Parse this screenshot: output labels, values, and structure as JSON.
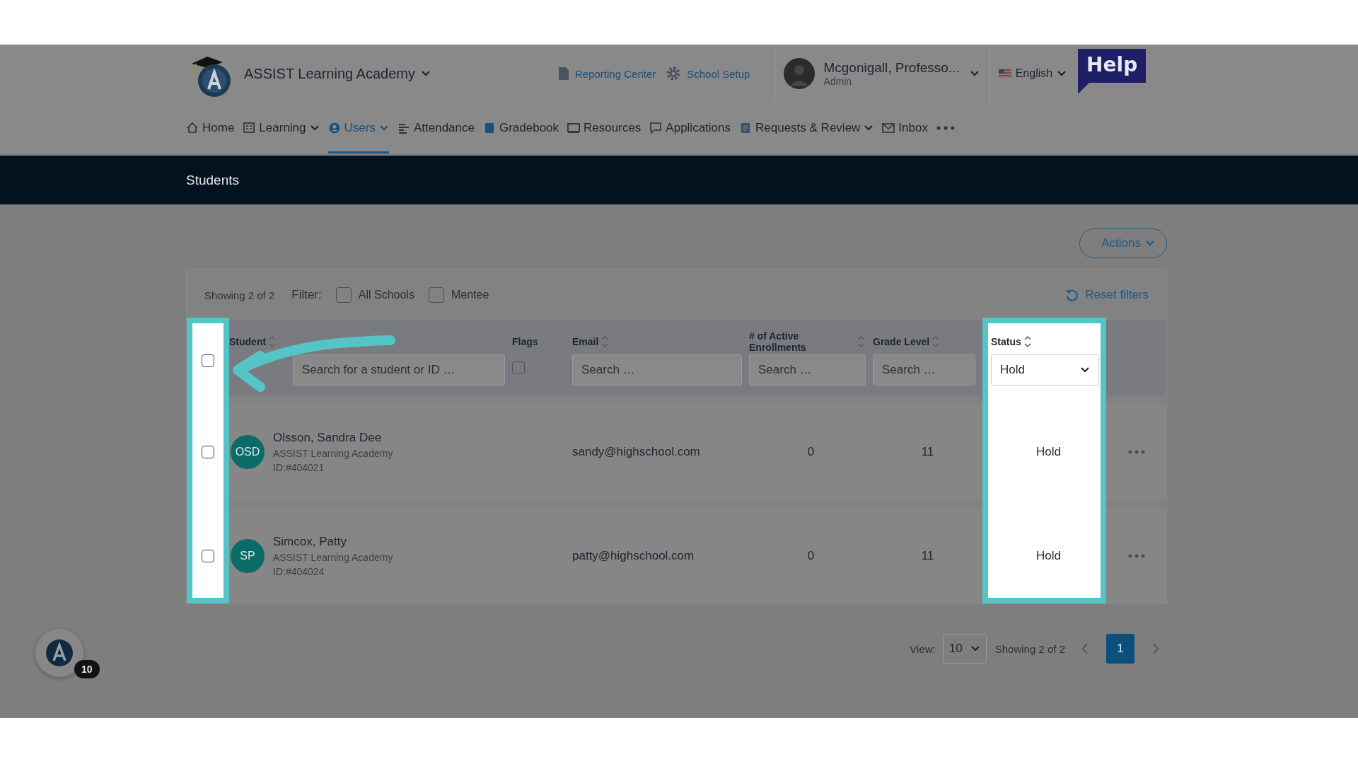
{
  "header": {
    "school": "ASSIST Learning Academy",
    "links": [
      {
        "kind": "report",
        "label": "Reporting Center"
      },
      {
        "kind": "setup",
        "label": "School Setup"
      }
    ],
    "user": {
      "name": "Mcgonigall, Professo...",
      "role": "Admin"
    },
    "language": "English",
    "help": "Help"
  },
  "nav": [
    {
      "kind": "home",
      "label": "Home",
      "selected": false,
      "dropdown": false
    },
    {
      "kind": "learning",
      "label": "Learning",
      "selected": false,
      "dropdown": true
    },
    {
      "kind": "users",
      "label": "Users",
      "selected": true,
      "dropdown": true
    },
    {
      "kind": "attendance",
      "label": "Attendance",
      "selected": false,
      "dropdown": false
    },
    {
      "kind": "gradebook",
      "label": "Gradebook",
      "selected": false,
      "dropdown": false
    },
    {
      "kind": "resources",
      "label": "Resources",
      "selected": false,
      "dropdown": false
    },
    {
      "kind": "applications",
      "label": "Applications",
      "selected": false,
      "dropdown": false
    },
    {
      "kind": "requests",
      "label": "Requests & Review",
      "selected": false,
      "dropdown": true
    },
    {
      "kind": "inbox",
      "label": "Inbox",
      "selected": false,
      "dropdown": false
    }
  ],
  "page_title": "Students",
  "actions": "Actions",
  "filters": {
    "showing": "Showing 2 of 2",
    "label": "Filter:",
    "options": [
      {
        "label": "All Schools",
        "checked": false
      },
      {
        "label": "Mentee",
        "checked": false
      }
    ],
    "reset": "Reset filters"
  },
  "table": {
    "select_column": {
      "highlighted": true,
      "select_all_checked": false
    },
    "columns": [
      {
        "label": "Student",
        "sortable": true,
        "highlighted": false,
        "filter": {
          "kind": "text",
          "placeholder": "Search for a student or ID …"
        }
      },
      {
        "label": "Flags",
        "sortable": false,
        "highlighted": false,
        "filter": {
          "kind": "checkbox",
          "checked": false
        }
      },
      {
        "label": "Email",
        "sortable": true,
        "highlighted": false,
        "filter": {
          "kind": "text",
          "placeholder": "Search …"
        }
      },
      {
        "label": "# of Active Enrollments",
        "sortable": true,
        "highlighted": false,
        "filter": {
          "kind": "text",
          "placeholder": "Search …"
        }
      },
      {
        "label": "Grade Level",
        "sortable": true,
        "highlighted": false,
        "filter": {
          "kind": "text",
          "placeholder": "Search …"
        }
      },
      {
        "label": "Status",
        "sortable": true,
        "highlighted": true,
        "filter": {
          "kind": "select",
          "value": "Hold"
        }
      }
    ],
    "rows": [
      {
        "checked": false,
        "initials": "OSD",
        "name": "Olsson, Sandra Dee",
        "school": "ASSIST Learning Academy",
        "id": "ID:#404021",
        "email": "sandy@highschool.com",
        "enrollments": "0",
        "grade": "11",
        "status": "Hold"
      },
      {
        "checked": false,
        "initials": "SP",
        "name": "Simcox, Patty",
        "school": "ASSIST Learning Academy",
        "id": "ID:#404024",
        "email": "patty@highschool.com",
        "enrollments": "0",
        "grade": "11",
        "status": "Hold"
      }
    ]
  },
  "pager": {
    "view_label": "View:",
    "page_size": "10",
    "showing": "Showing 2 of 2",
    "pages": [
      {
        "label": "1",
        "selected": true
      }
    ]
  },
  "badge": {
    "count": "10"
  }
}
